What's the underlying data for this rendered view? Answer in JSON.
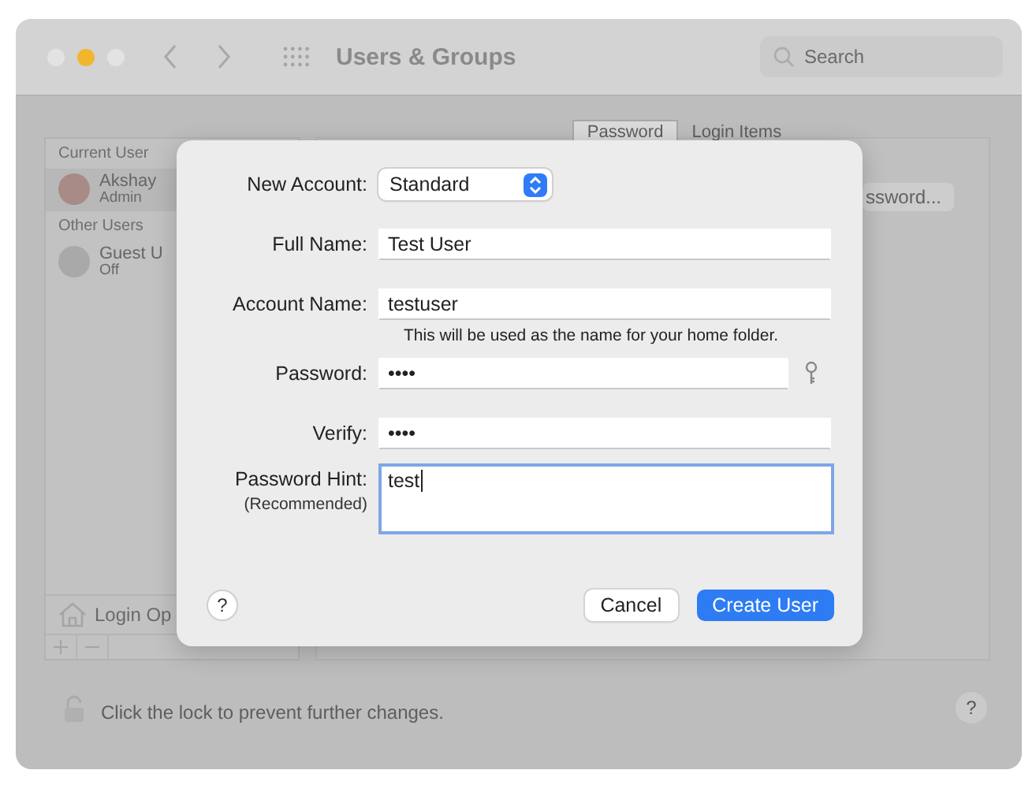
{
  "window": {
    "title": "Users & Groups",
    "search": {
      "placeholder": "Search"
    }
  },
  "sidebar": {
    "sections": [
      {
        "heading": "Current User",
        "users": [
          {
            "name": "Akshay",
            "role": "Admin"
          }
        ]
      },
      {
        "heading": "Other Users",
        "users": [
          {
            "name": "Guest U",
            "role": "Off"
          }
        ]
      }
    ],
    "login_options": "Login Op"
  },
  "tabs": [
    {
      "label": "Password",
      "selected": true
    },
    {
      "label": "Login Items",
      "selected": false
    }
  ],
  "change_password_button": "ssword...",
  "footer": {
    "lock_text": "Click the lock to prevent further changes."
  },
  "dialog": {
    "fields": [
      {
        "kind": "popup",
        "label": "New Account:",
        "value": "Standard"
      },
      {
        "kind": "text",
        "label": "Full Name:",
        "value": "Test User"
      },
      {
        "kind": "text",
        "label": "Account Name:",
        "value": "testuser",
        "note": "This will be used as the name for your home folder."
      },
      {
        "kind": "password",
        "label": "Password:",
        "value": "••••"
      },
      {
        "kind": "text",
        "label": "Verify:",
        "value": "••••"
      },
      {
        "kind": "textarea",
        "label": "Password Hint:",
        "sublabel": "(Recommended)",
        "value": "test",
        "focused": true
      }
    ],
    "help": "?",
    "buttons": [
      {
        "label": "Cancel",
        "kind": "secondary"
      },
      {
        "label": "Create User",
        "kind": "primary"
      }
    ]
  }
}
